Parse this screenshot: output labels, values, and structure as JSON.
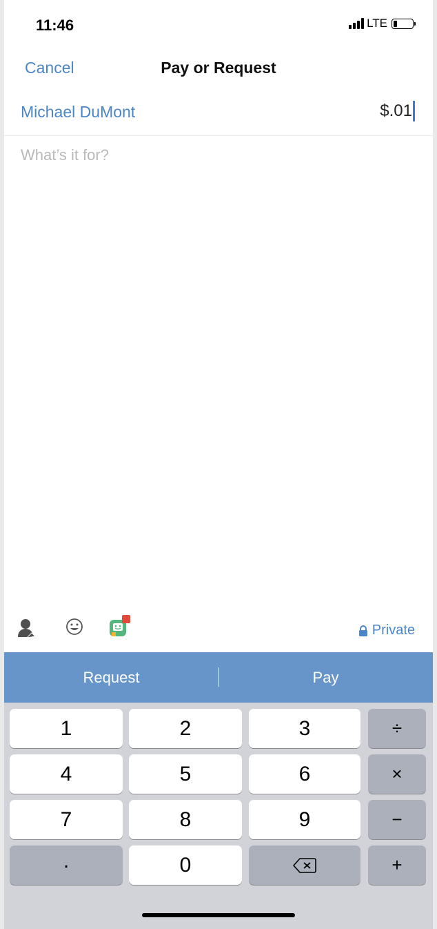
{
  "status_bar": {
    "time": "11:46",
    "network": "LTE"
  },
  "nav": {
    "cancel_label": "Cancel",
    "title": "Pay or Request"
  },
  "recipient": {
    "name": "Michael DuMont",
    "amount": "$.01"
  },
  "note": {
    "placeholder": "What’s it for?"
  },
  "toolbar": {
    "icons": [
      "tag-person-icon",
      "emoji-icon",
      "sticker-icon"
    ],
    "privacy_label": "Private"
  },
  "actions": {
    "request_label": "Request",
    "pay_label": "Pay"
  },
  "keypad": {
    "rows": [
      [
        "1",
        "2",
        "3",
        "÷"
      ],
      [
        "4",
        "5",
        "6",
        "×"
      ],
      [
        "7",
        "8",
        "9",
        "−"
      ],
      [
        ".",
        "0",
        "delete",
        "+"
      ]
    ]
  },
  "colors": {
    "accent": "#4a86c8",
    "action_bar": "#6795c9",
    "keyboard_bg": "#d1d3d9",
    "dark_key": "#abb0ba"
  }
}
